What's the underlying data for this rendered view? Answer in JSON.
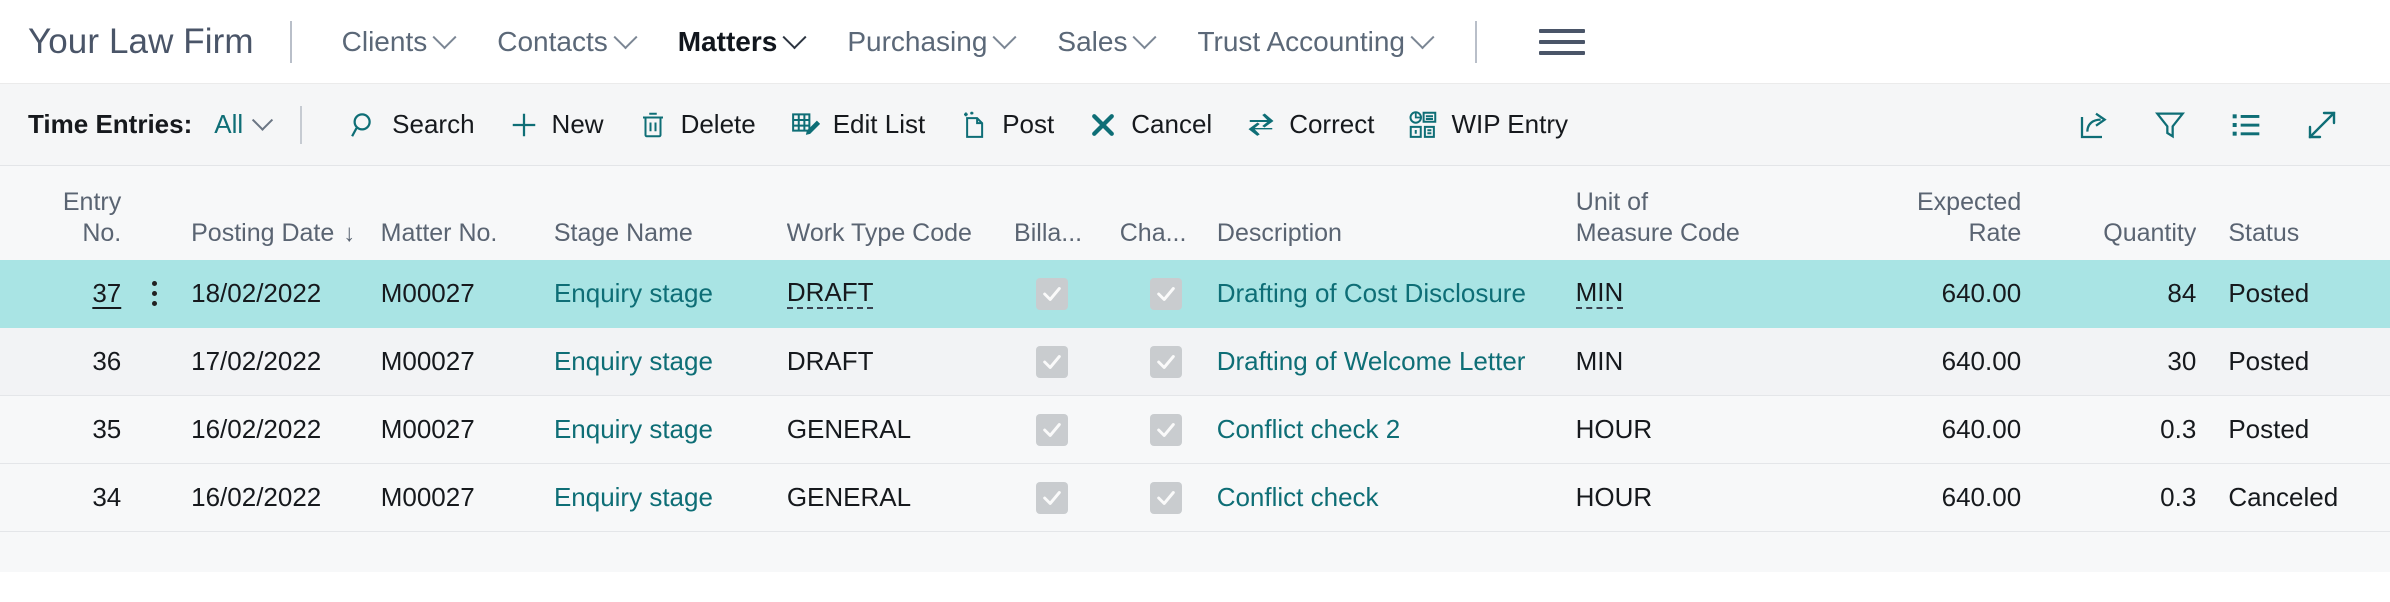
{
  "topnav": {
    "brand": "Your Law Firm",
    "items": [
      {
        "label": "Clients",
        "icon": "chevron-down-icon",
        "active": false
      },
      {
        "label": "Contacts",
        "icon": "chevron-down-icon",
        "active": false
      },
      {
        "label": "Matters",
        "icon": "chevron-down-icon",
        "active": true
      },
      {
        "label": "Purchasing",
        "icon": "chevron-down-icon",
        "active": false
      },
      {
        "label": "Sales",
        "icon": "chevron-down-icon",
        "active": false
      },
      {
        "label": "Trust Accounting",
        "icon": "chevron-down-icon",
        "active": false
      }
    ],
    "menu_icon": "hamburger-menu-icon"
  },
  "commandbar": {
    "title": "Time Entries:",
    "filter_value": "All",
    "filter_icon": "chevron-down-icon",
    "actions": [
      {
        "label": "Search",
        "icon": "search-icon"
      },
      {
        "label": "New",
        "icon": "plus-icon"
      },
      {
        "label": "Delete",
        "icon": "trash-icon"
      },
      {
        "label": "Edit List",
        "icon": "edit-list-icon"
      },
      {
        "label": "Post",
        "icon": "post-page-icon"
      },
      {
        "label": "Cancel",
        "icon": "x-icon"
      },
      {
        "label": "Correct",
        "icon": "swap-arrows-icon"
      },
      {
        "label": "WIP Entry",
        "icon": "wip-entry-icon"
      }
    ],
    "right_icons": [
      {
        "name": "share-export-icon"
      },
      {
        "name": "filter-funnel-icon"
      },
      {
        "name": "list-view-icon"
      },
      {
        "name": "expand-icon"
      }
    ]
  },
  "table": {
    "columns": [
      {
        "key": "entry",
        "label": "Entry\nNo."
      },
      {
        "key": "dots",
        "label": ""
      },
      {
        "key": "date",
        "label": "Posting Date",
        "sort": "↓"
      },
      {
        "key": "matter",
        "label": "Matter No."
      },
      {
        "key": "stage",
        "label": "Stage Name"
      },
      {
        "key": "work",
        "label": "Work Type Code"
      },
      {
        "key": "billa",
        "label": "Billa..."
      },
      {
        "key": "cha",
        "label": "Cha..."
      },
      {
        "key": "desc",
        "label": "Description"
      },
      {
        "key": "uom",
        "label": "Unit of\nMeasure Code"
      },
      {
        "key": "rate",
        "label": "Expected\nRate"
      },
      {
        "key": "qty",
        "label": "Quantity"
      },
      {
        "key": "status",
        "label": "Status"
      }
    ],
    "rows": [
      {
        "entry": "37",
        "date": "18/02/2022",
        "matter": "M00027",
        "stage": "Enquiry stage",
        "work": "DRAFT",
        "billable": true,
        "chargeable": true,
        "desc": "Drafting of Cost Disclosure",
        "uom": "MIN",
        "rate": "640.00",
        "qty": "84",
        "status": "Posted"
      },
      {
        "entry": "36",
        "date": "17/02/2022",
        "matter": "M00027",
        "stage": "Enquiry stage",
        "work": "DRAFT",
        "billable": true,
        "chargeable": true,
        "desc": "Drafting of Welcome Letter",
        "uom": "MIN",
        "rate": "640.00",
        "qty": "30",
        "status": "Posted"
      },
      {
        "entry": "35",
        "date": "16/02/2022",
        "matter": "M00027",
        "stage": "Enquiry stage",
        "work": "GENERAL",
        "billable": true,
        "chargeable": true,
        "desc": "Conflict check 2",
        "uom": "HOUR",
        "rate": "640.00",
        "qty": "0.3",
        "status": "Posted"
      },
      {
        "entry": "34",
        "date": "16/02/2022",
        "matter": "M00027",
        "stage": "Enquiry stage",
        "work": "GENERAL",
        "billable": true,
        "chargeable": true,
        "desc": "Conflict check",
        "uom": "HOUR",
        "rate": "640.00",
        "qty": "0.3",
        "status": "Canceled"
      }
    ],
    "selected_row_index": 0,
    "row_menu_icon": "vertical-ellipsis-icon"
  },
  "colors": {
    "accent_teal": "#0e6e76",
    "selection": "#a9e4e4",
    "nav_text": "#5b6878",
    "surface": "#f7f8f9"
  }
}
